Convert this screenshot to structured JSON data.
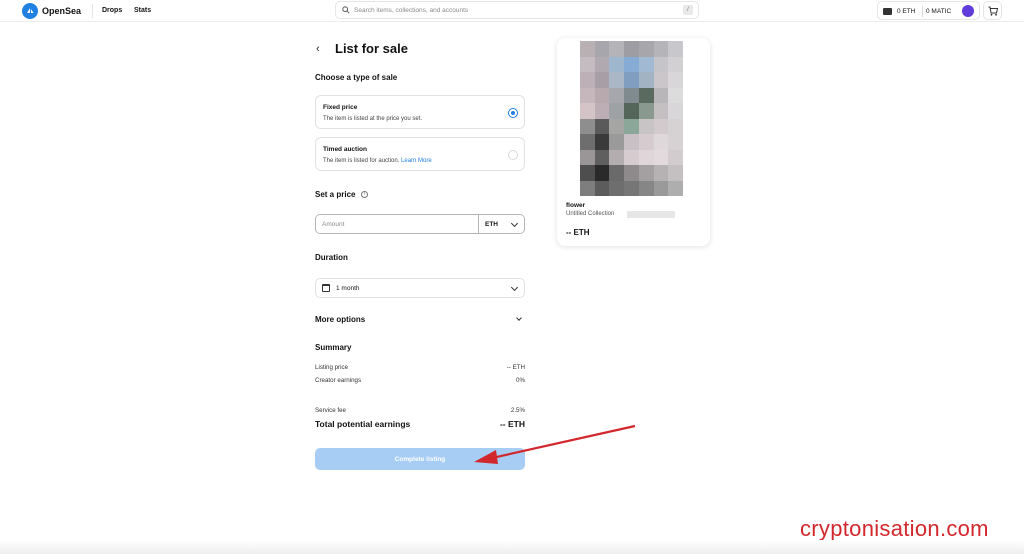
{
  "header": {
    "brand": "OpenSea",
    "nav": [
      "Drops",
      "Stats"
    ],
    "search_placeholder": "Search items, collections, and accounts",
    "search_shortcut": "/",
    "wallet_eth": "0 ETH",
    "wallet_matic": "0 MATIC"
  },
  "page": {
    "title": "List for sale",
    "sale_type_label": "Choose a type of sale",
    "sale_types": [
      {
        "title": "Fixed price",
        "desc": "The item is listed at the price you set.",
        "selected": true
      },
      {
        "title": "Timed auction",
        "desc": "The item is listed for auction.",
        "link": "Learn More",
        "selected": false
      }
    ],
    "price_label": "Set a price",
    "amount_placeholder": "Amount",
    "currency": "ETH",
    "duration_label": "Duration",
    "duration_value": "1 month",
    "more_options": "More options",
    "summary_label": "Summary",
    "summary_rows": [
      {
        "label": "Listing price",
        "value": "-- ETH"
      },
      {
        "label": "Creator earnings",
        "value": "0%"
      },
      {
        "label": "Service fee",
        "value": "2.5%"
      }
    ],
    "total_label": "Total potential earnings",
    "total_value": "-- ETH",
    "complete_button": "Complete listing"
  },
  "preview": {
    "name": "flower",
    "collection": "Untitled Collection",
    "price": "-- ETH",
    "pixel_colors": [
      "#b9b0b4",
      "#a8a6ad",
      "#b3b3b8",
      "#9d9da3",
      "#a6a6ab",
      "#b5b5b9",
      "#c8c8cc",
      "#c4bcc0",
      "#b0a9b0",
      "#9fb6cf",
      "#86acd6",
      "#a2b9d3",
      "#c5c5c9",
      "#d2d0d2",
      "#bdb0b6",
      "#a89ea6",
      "#aab7c7",
      "#7f9ec0",
      "#a2b3c4",
      "#cac6c9",
      "#d8d6d8",
      "#c6b7bc",
      "#b8a9af",
      "#a5a7ad",
      "#7f8b8f",
      "#5a6a5e",
      "#b8b6b8",
      "#dcdcdc",
      "#d4c4c8",
      "#bcaeb4",
      "#9ea2a4",
      "#54655a",
      "#8a9990",
      "#c4bfc1",
      "#d8d6d8",
      "#8e8e8e",
      "#5a5a5a",
      "#a5a5a3",
      "#8ba79a",
      "#c8c4c6",
      "#d2cacd",
      "#d6d2d4",
      "#6e6e6e",
      "#3a3a3a",
      "#9a9a9a",
      "#c8c0c4",
      "#d6ccd0",
      "#dfd8da",
      "#d6d2d4",
      "#9a9698",
      "#5f5f5f",
      "#b4adb0",
      "#d6cbcf",
      "#e0d6d9",
      "#e3dadd",
      "#d2ccce",
      "#4e4e4e",
      "#2a2a2a",
      "#6a6a6a",
      "#8e8a8c",
      "#a4a0a2",
      "#b6b2b4",
      "#c4c0c2",
      "#7e7e7e",
      "#5c5c5c",
      "#6e6e6e",
      "#767676",
      "#868686",
      "#9a9a9a",
      "#aeaeae"
    ]
  },
  "annotation": {
    "watermark": "cryptonisation.com",
    "arrow_color": "#d2282d"
  }
}
